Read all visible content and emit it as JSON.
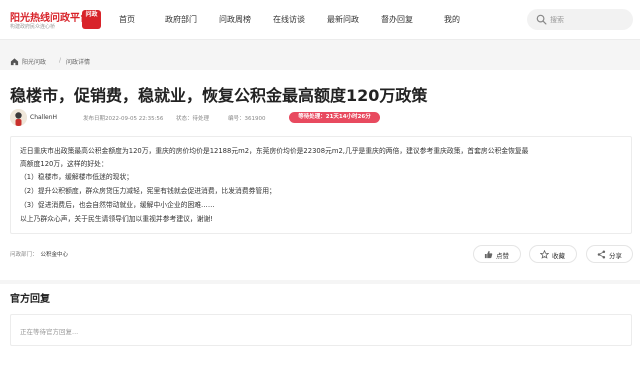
{
  "header": {
    "logo_title": "阳光热线问政平台",
    "logo_badge": "问政",
    "logo_sub": "构建政府民众连心桥",
    "nav": [
      "首页",
      "政府部门",
      "问政周榜",
      "在线访谈",
      "最新问政",
      "督办回复",
      "我的"
    ],
    "search_placeholder": "搜索"
  },
  "breadcrumb": {
    "items": [
      "阳光问政",
      "问政详情"
    ],
    "separator": "/"
  },
  "post": {
    "title": "稳楼市，促销费，稳就业，恢复公积金最高额度120万政策",
    "author": "ChallenH",
    "publish_time": "发布日期2022-09-05 22:35:56",
    "status": "状态：待处理",
    "number": "编号：361900",
    "waiting": "等待处理：21天14小时26分",
    "body_lines": [
      "近日重庆市出政策最高公积金额度为120万，重庆的房价均价是12188元m2，东莞房价均价是22308元m2,几乎是重庆的两倍，建议参考重庆政策，首套房公积金恢复最",
      "高额度120万，这样的好处：",
      "（1）稳楼市，缓解楼市低迷的现状；",
      "（2）提升公积额度，群众房贷压力减轻，宪里有钱就会促进消费，比发消费券管用；",
      "（3）促进消费后，也会自然带动就业，缓解中小企业的困难……",
      "以上乃群众心声，关于民生请领导们加以重视并参考建议，谢谢!"
    ],
    "department_label": "问政部门：",
    "department": "公积金中心",
    "actions": {
      "like": "点赞",
      "favorite": "收藏",
      "share": "分享"
    }
  },
  "reply": {
    "title": "官方回复",
    "placeholder": "正在等待官方回复..."
  },
  "colors": {
    "brand": "#d8232a",
    "status_pill": "#e84a5f"
  }
}
